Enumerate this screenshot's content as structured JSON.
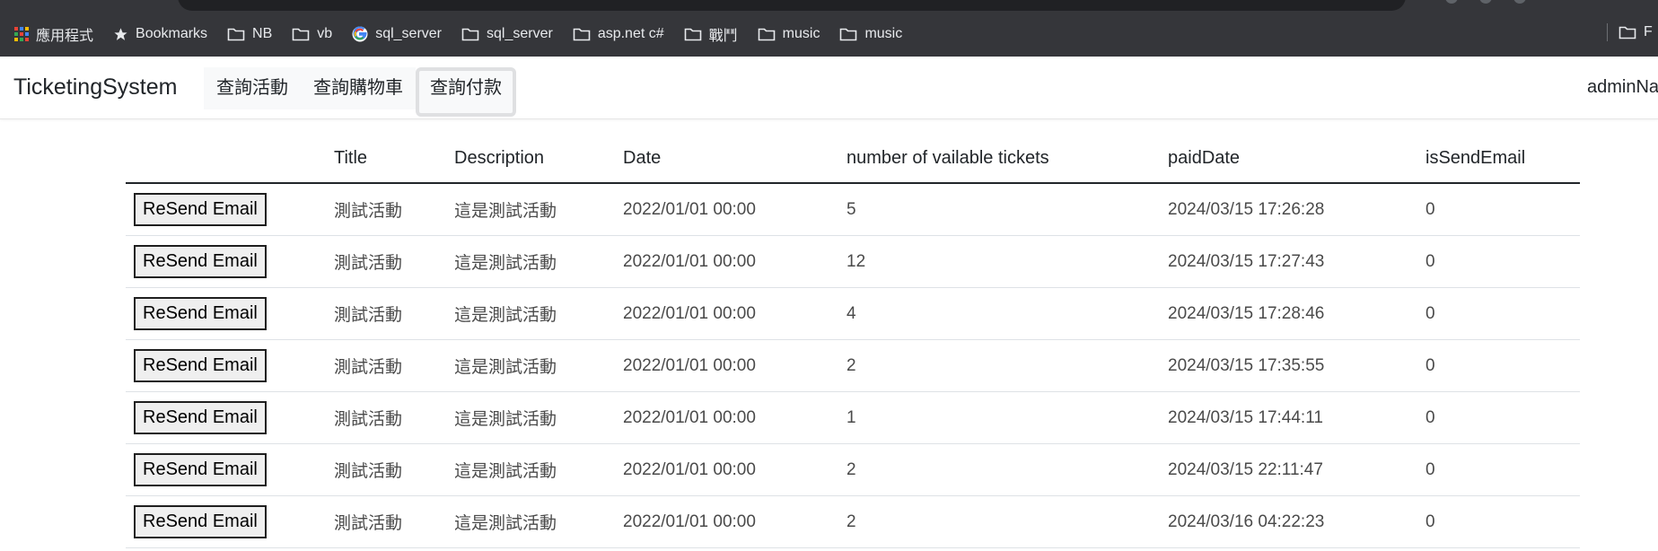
{
  "bookmarks_bar": {
    "items": [
      {
        "label": "應用程式",
        "icon": "apps-grid-icon"
      },
      {
        "label": "Bookmarks",
        "icon": "star-icon"
      },
      {
        "label": "NB",
        "icon": "folder-icon"
      },
      {
        "label": "vb",
        "icon": "folder-icon"
      },
      {
        "label": "sql_server",
        "icon": "google-icon"
      },
      {
        "label": "sql_server",
        "icon": "folder-icon"
      },
      {
        "label": "asp.net c#",
        "icon": "folder-icon"
      },
      {
        "label": "戰鬥",
        "icon": "folder-icon"
      },
      {
        "label": "music",
        "icon": "folder-icon"
      },
      {
        "label": "music",
        "icon": "folder-icon"
      }
    ],
    "overflow_label": "F"
  },
  "navbar": {
    "brand": "TicketingSystem",
    "links": [
      {
        "label": "查詢活動"
      },
      {
        "label": "查詢購物車"
      },
      {
        "label": "查詢付款",
        "active": true
      }
    ],
    "user": "adminNa"
  },
  "table": {
    "headers": [
      "",
      "Title",
      "Description",
      "Date",
      "number of vailable tickets",
      "paidDate",
      "isSendEmail"
    ],
    "button_label": "ReSend Email",
    "rows": [
      {
        "title": "測試活動",
        "description": "這是測試活動",
        "date": "2022/01/01 00:00",
        "tickets": "5",
        "paid_date": "2024/03/15 17:26:28",
        "is_send_email": "0"
      },
      {
        "title": "測試活動",
        "description": "這是測試活動",
        "date": "2022/01/01 00:00",
        "tickets": "12",
        "paid_date": "2024/03/15 17:27:43",
        "is_send_email": "0"
      },
      {
        "title": "測試活動",
        "description": "這是測試活動",
        "date": "2022/01/01 00:00",
        "tickets": "4",
        "paid_date": "2024/03/15 17:28:46",
        "is_send_email": "0"
      },
      {
        "title": "測試活動",
        "description": "這是測試活動",
        "date": "2022/01/01 00:00",
        "tickets": "2",
        "paid_date": "2024/03/15 17:35:55",
        "is_send_email": "0"
      },
      {
        "title": "測試活動",
        "description": "這是測試活動",
        "date": "2022/01/01 00:00",
        "tickets": "1",
        "paid_date": "2024/03/15 17:44:11",
        "is_send_email": "0"
      },
      {
        "title": "測試活動",
        "description": "這是測試活動",
        "date": "2022/01/01 00:00",
        "tickets": "2",
        "paid_date": "2024/03/15 22:11:47",
        "is_send_email": "0"
      },
      {
        "title": "測試活動",
        "description": "這是測試活動",
        "date": "2022/01/01 00:00",
        "tickets": "2",
        "paid_date": "2024/03/16 04:22:23",
        "is_send_email": "0"
      }
    ]
  },
  "colors": {
    "chrome_bar": "#35363a",
    "chrome_text": "#e8eaed",
    "page_bg": "#ffffff",
    "text": "#212529",
    "active_nav_border": "#dfe0e2"
  }
}
